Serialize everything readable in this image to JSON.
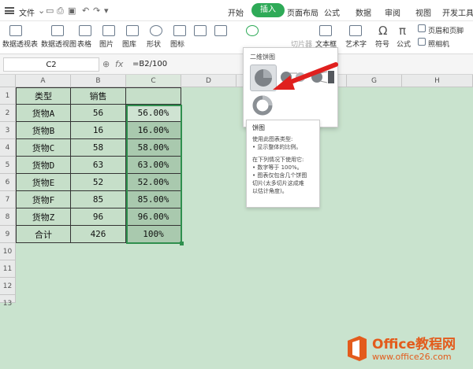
{
  "app": {
    "file_menu": "文件",
    "quick_icons": [
      "menu-icon",
      "print-icon",
      "preview-icon",
      "undo-icon",
      "redo-icon",
      "more-icon"
    ]
  },
  "tabs": [
    {
      "label": "开始"
    },
    {
      "label": "插入",
      "active": true
    },
    {
      "label": "页面布局"
    },
    {
      "label": "公式"
    },
    {
      "label": "数据"
    },
    {
      "label": "审阅"
    },
    {
      "label": "视图"
    },
    {
      "label": "开发工具"
    }
  ],
  "ribbon": {
    "items": [
      "数据透视表",
      "数据透视图",
      "表格",
      "图片",
      "图库",
      "形状",
      "图标",
      "文本框",
      "艺术字",
      "符号",
      "公式",
      "页眉和页脚",
      "照相机"
    ],
    "disabled_item": "切片器",
    "colors": {
      "active_tab": "#2eaa57"
    }
  },
  "formula_bar": {
    "name_box": "C2",
    "fx": "fx",
    "value": "=B2/100"
  },
  "columns": [
    "A",
    "B",
    "C",
    "D",
    "E",
    "F",
    "G",
    "H"
  ],
  "rows": [
    "1",
    "2",
    "3",
    "4",
    "5",
    "6",
    "7",
    "8",
    "9",
    "10",
    "11",
    "12",
    "13"
  ],
  "table": {
    "headers": [
      "类型",
      "销售",
      ""
    ],
    "rows": [
      [
        "货物A",
        "56",
        "56.00%"
      ],
      [
        "货物B",
        "16",
        "16.00%"
      ],
      [
        "货物C",
        "58",
        "58.00%"
      ],
      [
        "货物D",
        "63",
        "63.00%"
      ],
      [
        "货物E",
        "52",
        "52.00%"
      ],
      [
        "货物F",
        "85",
        "85.00%"
      ],
      [
        "货物Z",
        "96",
        "96.00%"
      ],
      [
        "合计",
        "426",
        "100%"
      ]
    ]
  },
  "chart_menu": {
    "section_title": "二维饼图"
  },
  "tooltip": {
    "title": "饼图",
    "lines": [
      "使用此图表类型:",
      "• 显示整体的比例。",
      "",
      "在下列情况下使用它:",
      "• 数字等于 100%。",
      "• 图表仅包含几个饼图",
      "切片(太多切片这成难",
      "以估计角度)。"
    ]
  },
  "watermark": {
    "brand": "Office教程网",
    "url": "www.office26.com"
  }
}
